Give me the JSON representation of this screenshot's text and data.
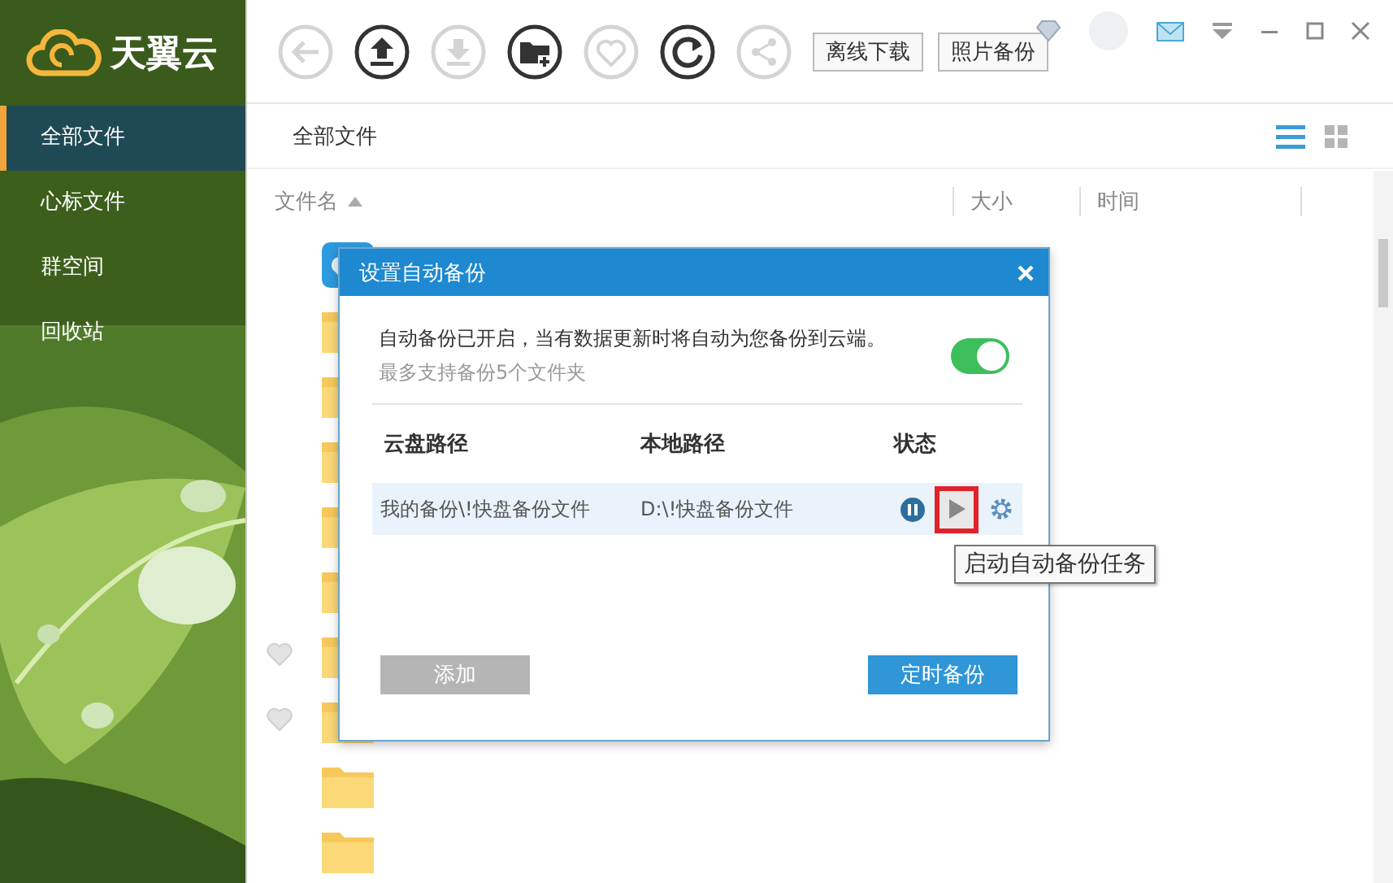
{
  "app": {
    "name": "天翼云"
  },
  "sidebar": {
    "items": [
      {
        "label": "全部文件",
        "selected": true
      },
      {
        "label": "心标文件",
        "selected": false
      },
      {
        "label": "群空间",
        "selected": false
      },
      {
        "label": "回收站",
        "selected": false
      }
    ]
  },
  "toolbar": {
    "icons": [
      {
        "kind": "back",
        "disabled": true
      },
      {
        "kind": "upload",
        "disabled": false
      },
      {
        "kind": "download",
        "disabled": true
      },
      {
        "kind": "new-folder",
        "disabled": false
      },
      {
        "kind": "favorite",
        "disabled": true
      },
      {
        "kind": "refresh",
        "disabled": false
      },
      {
        "kind": "share",
        "disabled": true
      }
    ],
    "buttons": [
      "离线下载",
      "照片备份"
    ]
  },
  "breadcrumb": "全部文件",
  "view_modes": [
    {
      "kind": "list",
      "selected": true
    },
    {
      "kind": "grid",
      "selected": false
    }
  ],
  "table": {
    "columns": [
      "文件名",
      "大小",
      "时间"
    ]
  },
  "file_rows": [
    {
      "kind": "app",
      "heart": false
    },
    {
      "kind": "folder",
      "heart": false
    },
    {
      "kind": "folder",
      "heart": false
    },
    {
      "kind": "folder",
      "heart": false
    },
    {
      "kind": "folder",
      "heart": false
    },
    {
      "kind": "folder",
      "heart": false
    },
    {
      "kind": "folder",
      "heart": true
    },
    {
      "kind": "folder",
      "heart": true
    },
    {
      "kind": "folder",
      "heart": false
    },
    {
      "kind": "folder",
      "heart": false
    }
  ],
  "dialog": {
    "title": "设置自动备份",
    "message": "自动备份已开启，当有数据更新时将自动为您备份到云端。",
    "hint": "最多支持备份5个文件夹",
    "auto_backup_on": true,
    "columns": [
      "云盘路径",
      "本地路径",
      "状态"
    ],
    "rows": [
      {
        "cloud_path": "我的备份\\!快盘备份文件",
        "local_path": "D:\\!快盘备份文件",
        "highlighted": true
      }
    ],
    "tooltip": "启动自动备份任务",
    "buttons": [
      {
        "label": "添加",
        "disabled": true
      },
      {
        "label": "定时备份",
        "disabled": false
      }
    ]
  }
}
